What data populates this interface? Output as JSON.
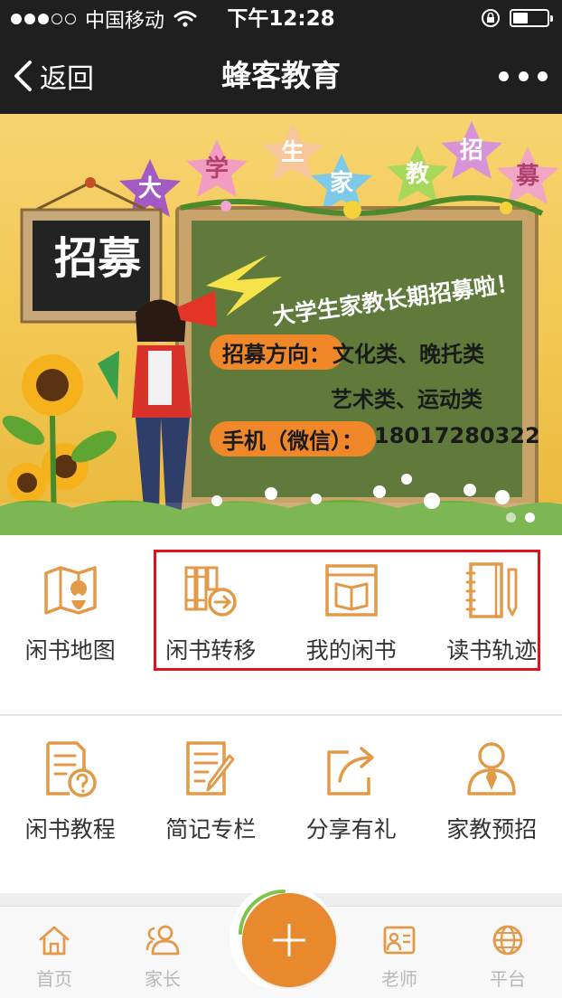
{
  "status_bar": {
    "carrier": "中国移动",
    "time": "下午12:28",
    "battery_level": 0.45
  },
  "nav": {
    "back_label": "返回",
    "title": "蜂客教育"
  },
  "banner": {
    "star_chars": [
      "大",
      "学",
      "生",
      "家",
      "教",
      "招",
      "募"
    ],
    "sign_text": "招募",
    "board_heading": "大学生家教长期招募啦！",
    "direction_label": "招募方向：",
    "direction_line1": "文化类、晚托类",
    "direction_line2": "艺术类、运动类",
    "phone_label": "手机（微信）：",
    "phone_number": "18017280322",
    "slide_count": 2,
    "active_slide": 1
  },
  "menu_row1": [
    {
      "label": "闲书地图",
      "icon": "map-pin-icon"
    },
    {
      "label": "闲书转移",
      "icon": "book-transfer-icon"
    },
    {
      "label": "我的闲书",
      "icon": "my-book-icon"
    },
    {
      "label": "读书轨迹",
      "icon": "notebook-icon"
    }
  ],
  "menu_row2": [
    {
      "label": "闲书教程",
      "icon": "document-question-icon"
    },
    {
      "label": "简记专栏",
      "icon": "note-edit-icon"
    },
    {
      "label": "分享有礼",
      "icon": "share-icon"
    },
    {
      "label": "家教预招",
      "icon": "person-tie-icon"
    }
  ],
  "tab_bar": {
    "tabs": [
      {
        "label": "首页",
        "icon": "home-icon"
      },
      {
        "label": "家长",
        "icon": "parents-icon"
      },
      {
        "label": "老师",
        "icon": "teacher-card-icon"
      },
      {
        "label": "平台",
        "icon": "globe-icon"
      }
    ],
    "fab_icon": "plus-icon"
  },
  "colors": {
    "accent": "#e8892d",
    "icon_orange": "#e39a48",
    "highlight_border": "#e30f1a",
    "header_bg": "#1f1f1f",
    "tab_inactive": "#b8b8b8"
  }
}
